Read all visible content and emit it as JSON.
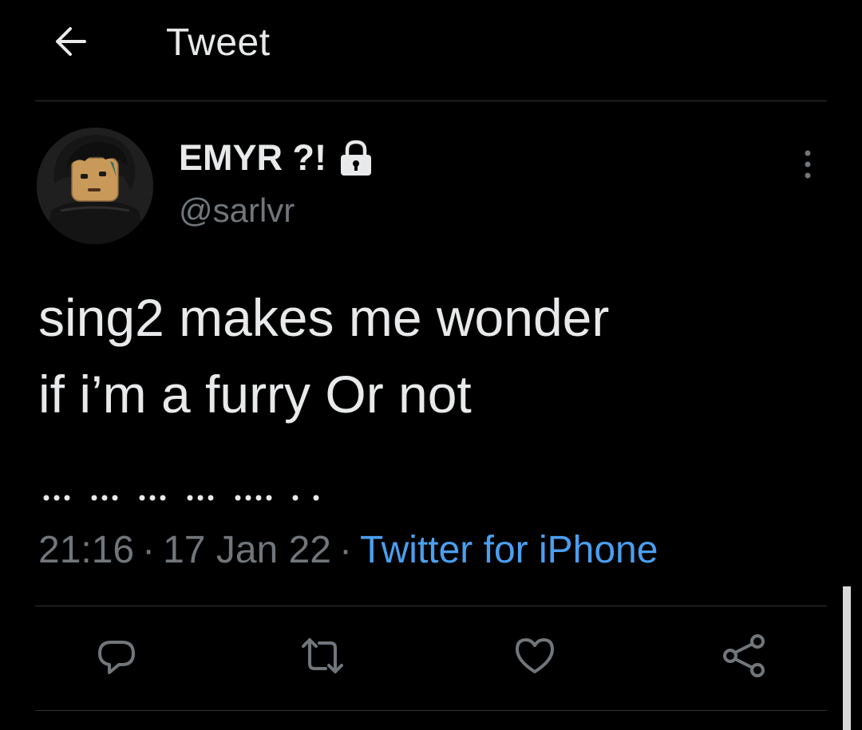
{
  "header": {
    "title": "Tweet",
    "back_icon": "arrow-left-icon"
  },
  "author": {
    "display_name": "EMYR ?!",
    "handle": "@sarlvr",
    "protected_icon": "lock-icon",
    "avatar_icon": "lego-minifigure-avatar"
  },
  "tweet": {
    "lines": [
      "sing2 makes me wonder",
      "if i’m a furry Or not"
    ],
    "time": "21:16",
    "date": "17 Jan 22",
    "separator": "·",
    "source": "Twitter for iPhone"
  },
  "actions": {
    "reply_icon": "reply-icon",
    "retweet_icon": "retweet-icon",
    "like_icon": "heart-icon",
    "share_icon": "share-icon",
    "more_icon": "more-vertical-icon"
  },
  "colors": {
    "background": "#000000",
    "text": "#e7e9ea",
    "secondary": "#71767b",
    "link": "#4a9ff0",
    "divider": "#2f3336"
  }
}
